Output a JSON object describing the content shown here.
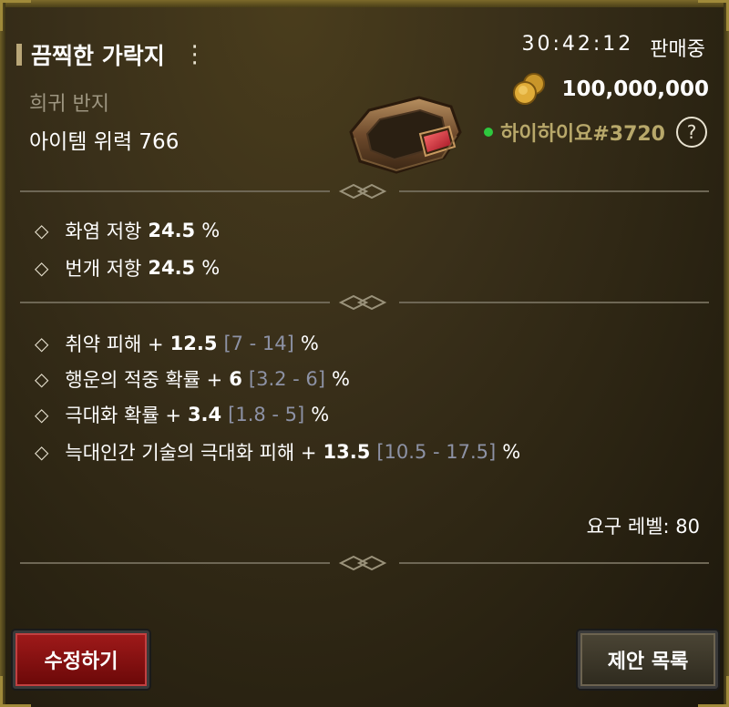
{
  "item": {
    "name": "끔찍한 가락지",
    "rarity": "희귀 반지",
    "power_label": "아이템 위력 766"
  },
  "listing": {
    "timer": "30:42:12",
    "status": "판매중",
    "price": "100,000,000",
    "seller": "하이하이요#3720",
    "seller_online": true
  },
  "base_stats": [
    {
      "name": "화염 저항",
      "value": "24.5",
      "unit": "%"
    },
    {
      "name": "번개 저항",
      "value": "24.5",
      "unit": "%"
    }
  ],
  "affixes": [
    {
      "name": "취약 피해 +",
      "value": "12.5",
      "range": "[7 - 14]",
      "unit": "%"
    },
    {
      "name": "행운의 적중 확률 +",
      "value": "6",
      "range": "[3.2 - 6]",
      "unit": "%"
    },
    {
      "name": "극대화 확률 +",
      "value": "3.4",
      "range": "[1.8 - 5]",
      "unit": "%"
    },
    {
      "name": "늑대인간 기술의 극대화 피해 +",
      "value": "13.5",
      "range": "[10.5 - 17.5]",
      "unit": "%"
    }
  ],
  "requirement": "요구 레벨: 80",
  "buttons": {
    "edit": "수정하기",
    "offers": "제안 목록"
  },
  "icons": {
    "more": "kebab-menu-icon",
    "help": "question-icon",
    "coin": "gold-coin-icon",
    "bullet": "diamond-bullet-icon"
  },
  "colors": {
    "background": "#3a301a",
    "rarity_text": "#9d9580",
    "seller_text": "#b8a86a",
    "range_text": "#8d92a5",
    "edit_button": "#8a1010",
    "online": "#2ec83e"
  }
}
